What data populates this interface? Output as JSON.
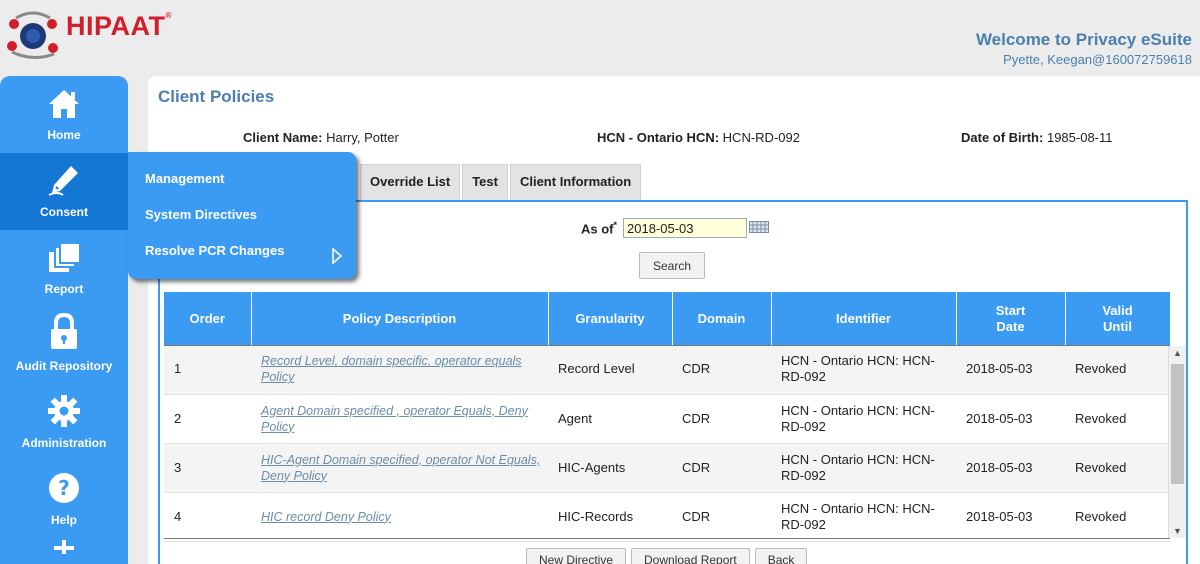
{
  "header": {
    "logo_text": "HIPAAT",
    "logo_reg": "®",
    "welcome_title": "Welcome to Privacy eSuite",
    "user_line": "Pyette, Keegan@160072759618"
  },
  "sidebar": {
    "items": [
      {
        "label": "Home",
        "icon": "home-icon"
      },
      {
        "label": "Consent",
        "icon": "pen-icon"
      },
      {
        "label": "Report",
        "icon": "report-icon"
      },
      {
        "label": "Audit Repository",
        "icon": "lock-icon"
      },
      {
        "label": "Administration",
        "icon": "gear-icon"
      },
      {
        "label": "Help",
        "icon": "help-icon"
      }
    ],
    "active": "Consent"
  },
  "flyout": {
    "items": [
      "Management",
      "System Directives",
      "Resolve PCR Changes"
    ]
  },
  "page": {
    "title": "Client Policies",
    "client_name_label": "Client Name:",
    "client_name": "Harry, Potter",
    "hcn_label": "HCN - Ontario HCN:",
    "hcn": "HCN-RD-092",
    "dob_label": "Date of Birth:",
    "dob": "1985-08-11"
  },
  "tabs": [
    "Override List",
    "Test",
    "Client Information"
  ],
  "filter": {
    "asof_label": "As of",
    "required_mark": "*",
    "date_value": "2018-05-03",
    "search_label": "Search"
  },
  "table": {
    "headers": [
      "Order",
      "Policy Description",
      "Granularity",
      "Domain",
      "Identifier",
      "Start Date",
      "Valid Until"
    ],
    "rows": [
      {
        "order": "1",
        "description": "Record Level, domain specific, operator equals Policy",
        "granularity": "Record Level",
        "domain": "CDR",
        "identifier": "HCN - Ontario HCN: HCN-RD-092",
        "start": "2018-05-03",
        "valid": "Revoked"
      },
      {
        "order": "2",
        "description": "Agent Domain specified , operator Equals, Deny Policy",
        "granularity": "Agent",
        "domain": "CDR",
        "identifier": "HCN - Ontario HCN: HCN-RD-092",
        "start": "2018-05-03",
        "valid": "Revoked"
      },
      {
        "order": "3",
        "description": "HIC-Agent Domain specified, operator Not Equals, Deny Policy",
        "granularity": "HIC-Agents",
        "domain": "CDR",
        "identifier": "HCN - Ontario HCN: HCN-RD-092",
        "start": "2018-05-03",
        "valid": "Revoked"
      },
      {
        "order": "4",
        "description": "HIC record Deny Policy",
        "granularity": "HIC-Records",
        "domain": "CDR",
        "identifier": "HCN - Ontario HCN: HCN-RD-092",
        "start": "2018-05-03",
        "valid": "Revoked"
      }
    ]
  },
  "actions": {
    "new_directive": "New Directive",
    "download_report": "Download Report",
    "back": "Back"
  },
  "colors": {
    "accent": "#3b9bf2",
    "accent_dark": "#1577d4",
    "title_blue": "#4a7fae",
    "logo_red": "#d01f2a"
  }
}
